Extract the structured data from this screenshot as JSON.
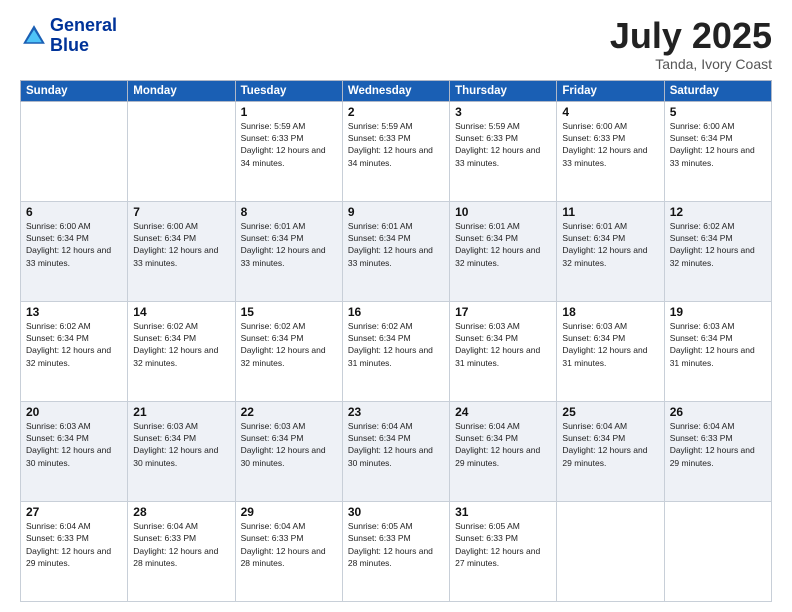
{
  "logo": {
    "line1": "General",
    "line2": "Blue"
  },
  "title": "July 2025",
  "location": "Tanda, Ivory Coast",
  "weekdays": [
    "Sunday",
    "Monday",
    "Tuesday",
    "Wednesday",
    "Thursday",
    "Friday",
    "Saturday"
  ],
  "weeks": [
    [
      {
        "day": "",
        "sunrise": "",
        "sunset": "",
        "daylight": ""
      },
      {
        "day": "",
        "sunrise": "",
        "sunset": "",
        "daylight": ""
      },
      {
        "day": "1",
        "sunrise": "Sunrise: 5:59 AM",
        "sunset": "Sunset: 6:33 PM",
        "daylight": "Daylight: 12 hours and 34 minutes."
      },
      {
        "day": "2",
        "sunrise": "Sunrise: 5:59 AM",
        "sunset": "Sunset: 6:33 PM",
        "daylight": "Daylight: 12 hours and 34 minutes."
      },
      {
        "day": "3",
        "sunrise": "Sunrise: 5:59 AM",
        "sunset": "Sunset: 6:33 PM",
        "daylight": "Daylight: 12 hours and 33 minutes."
      },
      {
        "day": "4",
        "sunrise": "Sunrise: 6:00 AM",
        "sunset": "Sunset: 6:33 PM",
        "daylight": "Daylight: 12 hours and 33 minutes."
      },
      {
        "day": "5",
        "sunrise": "Sunrise: 6:00 AM",
        "sunset": "Sunset: 6:34 PM",
        "daylight": "Daylight: 12 hours and 33 minutes."
      }
    ],
    [
      {
        "day": "6",
        "sunrise": "Sunrise: 6:00 AM",
        "sunset": "Sunset: 6:34 PM",
        "daylight": "Daylight: 12 hours and 33 minutes."
      },
      {
        "day": "7",
        "sunrise": "Sunrise: 6:00 AM",
        "sunset": "Sunset: 6:34 PM",
        "daylight": "Daylight: 12 hours and 33 minutes."
      },
      {
        "day": "8",
        "sunrise": "Sunrise: 6:01 AM",
        "sunset": "Sunset: 6:34 PM",
        "daylight": "Daylight: 12 hours and 33 minutes."
      },
      {
        "day": "9",
        "sunrise": "Sunrise: 6:01 AM",
        "sunset": "Sunset: 6:34 PM",
        "daylight": "Daylight: 12 hours and 33 minutes."
      },
      {
        "day": "10",
        "sunrise": "Sunrise: 6:01 AM",
        "sunset": "Sunset: 6:34 PM",
        "daylight": "Daylight: 12 hours and 32 minutes."
      },
      {
        "day": "11",
        "sunrise": "Sunrise: 6:01 AM",
        "sunset": "Sunset: 6:34 PM",
        "daylight": "Daylight: 12 hours and 32 minutes."
      },
      {
        "day": "12",
        "sunrise": "Sunrise: 6:02 AM",
        "sunset": "Sunset: 6:34 PM",
        "daylight": "Daylight: 12 hours and 32 minutes."
      }
    ],
    [
      {
        "day": "13",
        "sunrise": "Sunrise: 6:02 AM",
        "sunset": "Sunset: 6:34 PM",
        "daylight": "Daylight: 12 hours and 32 minutes."
      },
      {
        "day": "14",
        "sunrise": "Sunrise: 6:02 AM",
        "sunset": "Sunset: 6:34 PM",
        "daylight": "Daylight: 12 hours and 32 minutes."
      },
      {
        "day": "15",
        "sunrise": "Sunrise: 6:02 AM",
        "sunset": "Sunset: 6:34 PM",
        "daylight": "Daylight: 12 hours and 32 minutes."
      },
      {
        "day": "16",
        "sunrise": "Sunrise: 6:02 AM",
        "sunset": "Sunset: 6:34 PM",
        "daylight": "Daylight: 12 hours and 31 minutes."
      },
      {
        "day": "17",
        "sunrise": "Sunrise: 6:03 AM",
        "sunset": "Sunset: 6:34 PM",
        "daylight": "Daylight: 12 hours and 31 minutes."
      },
      {
        "day": "18",
        "sunrise": "Sunrise: 6:03 AM",
        "sunset": "Sunset: 6:34 PM",
        "daylight": "Daylight: 12 hours and 31 minutes."
      },
      {
        "day": "19",
        "sunrise": "Sunrise: 6:03 AM",
        "sunset": "Sunset: 6:34 PM",
        "daylight": "Daylight: 12 hours and 31 minutes."
      }
    ],
    [
      {
        "day": "20",
        "sunrise": "Sunrise: 6:03 AM",
        "sunset": "Sunset: 6:34 PM",
        "daylight": "Daylight: 12 hours and 30 minutes."
      },
      {
        "day": "21",
        "sunrise": "Sunrise: 6:03 AM",
        "sunset": "Sunset: 6:34 PM",
        "daylight": "Daylight: 12 hours and 30 minutes."
      },
      {
        "day": "22",
        "sunrise": "Sunrise: 6:03 AM",
        "sunset": "Sunset: 6:34 PM",
        "daylight": "Daylight: 12 hours and 30 minutes."
      },
      {
        "day": "23",
        "sunrise": "Sunrise: 6:04 AM",
        "sunset": "Sunset: 6:34 PM",
        "daylight": "Daylight: 12 hours and 30 minutes."
      },
      {
        "day": "24",
        "sunrise": "Sunrise: 6:04 AM",
        "sunset": "Sunset: 6:34 PM",
        "daylight": "Daylight: 12 hours and 29 minutes."
      },
      {
        "day": "25",
        "sunrise": "Sunrise: 6:04 AM",
        "sunset": "Sunset: 6:34 PM",
        "daylight": "Daylight: 12 hours and 29 minutes."
      },
      {
        "day": "26",
        "sunrise": "Sunrise: 6:04 AM",
        "sunset": "Sunset: 6:33 PM",
        "daylight": "Daylight: 12 hours and 29 minutes."
      }
    ],
    [
      {
        "day": "27",
        "sunrise": "Sunrise: 6:04 AM",
        "sunset": "Sunset: 6:33 PM",
        "daylight": "Daylight: 12 hours and 29 minutes."
      },
      {
        "day": "28",
        "sunrise": "Sunrise: 6:04 AM",
        "sunset": "Sunset: 6:33 PM",
        "daylight": "Daylight: 12 hours and 28 minutes."
      },
      {
        "day": "29",
        "sunrise": "Sunrise: 6:04 AM",
        "sunset": "Sunset: 6:33 PM",
        "daylight": "Daylight: 12 hours and 28 minutes."
      },
      {
        "day": "30",
        "sunrise": "Sunrise: 6:05 AM",
        "sunset": "Sunset: 6:33 PM",
        "daylight": "Daylight: 12 hours and 28 minutes."
      },
      {
        "day": "31",
        "sunrise": "Sunrise: 6:05 AM",
        "sunset": "Sunset: 6:33 PM",
        "daylight": "Daylight: 12 hours and 27 minutes."
      },
      {
        "day": "",
        "sunrise": "",
        "sunset": "",
        "daylight": ""
      },
      {
        "day": "",
        "sunrise": "",
        "sunset": "",
        "daylight": ""
      }
    ]
  ]
}
